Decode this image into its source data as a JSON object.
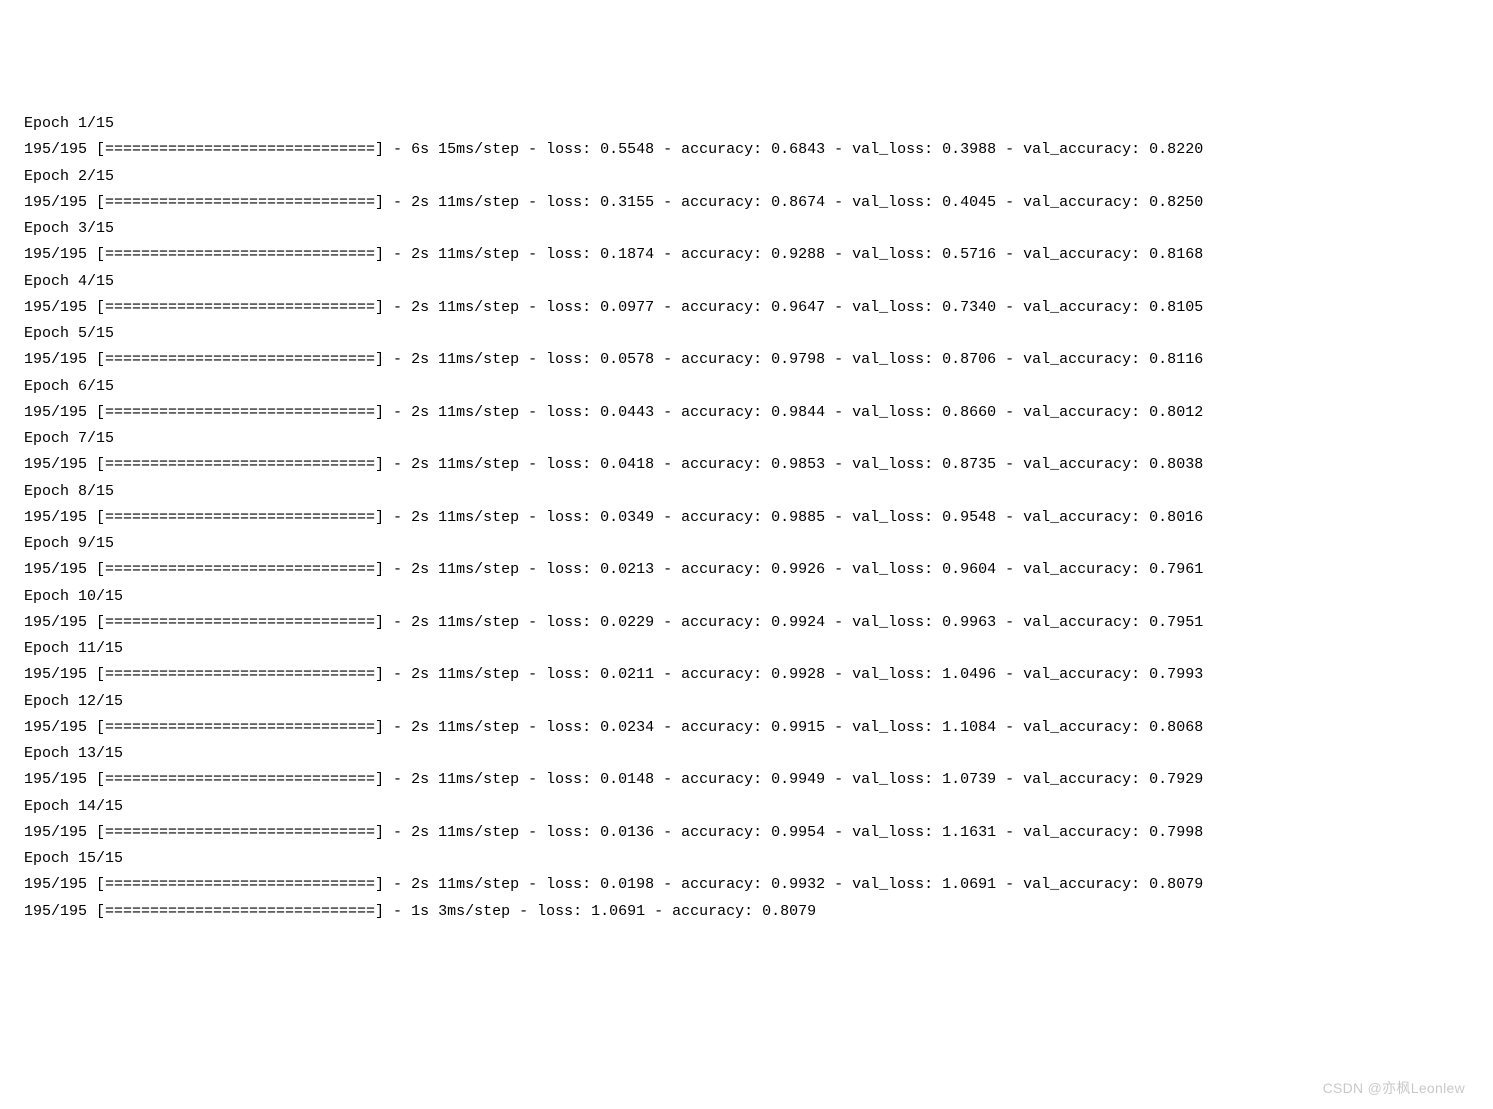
{
  "watermark": "CSDN @亦枫Leonlew",
  "log": {
    "stepsDisplay": "195/195",
    "bar": "[==============================]",
    "totalEpochs": 15,
    "epochs": [
      {
        "epoch": 1,
        "time": "6s 15ms/step",
        "loss": "0.5548",
        "accuracy": "0.6843",
        "val_loss": "0.3988",
        "val_accuracy": "0.8220"
      },
      {
        "epoch": 2,
        "time": "2s 11ms/step",
        "loss": "0.3155",
        "accuracy": "0.8674",
        "val_loss": "0.4045",
        "val_accuracy": "0.8250"
      },
      {
        "epoch": 3,
        "time": "2s 11ms/step",
        "loss": "0.1874",
        "accuracy": "0.9288",
        "val_loss": "0.5716",
        "val_accuracy": "0.8168"
      },
      {
        "epoch": 4,
        "time": "2s 11ms/step",
        "loss": "0.0977",
        "accuracy": "0.9647",
        "val_loss": "0.7340",
        "val_accuracy": "0.8105"
      },
      {
        "epoch": 5,
        "time": "2s 11ms/step",
        "loss": "0.0578",
        "accuracy": "0.9798",
        "val_loss": "0.8706",
        "val_accuracy": "0.8116"
      },
      {
        "epoch": 6,
        "time": "2s 11ms/step",
        "loss": "0.0443",
        "accuracy": "0.9844",
        "val_loss": "0.8660",
        "val_accuracy": "0.8012"
      },
      {
        "epoch": 7,
        "time": "2s 11ms/step",
        "loss": "0.0418",
        "accuracy": "0.9853",
        "val_loss": "0.8735",
        "val_accuracy": "0.8038"
      },
      {
        "epoch": 8,
        "time": "2s 11ms/step",
        "loss": "0.0349",
        "accuracy": "0.9885",
        "val_loss": "0.9548",
        "val_accuracy": "0.8016"
      },
      {
        "epoch": 9,
        "time": "2s 11ms/step",
        "loss": "0.0213",
        "accuracy": "0.9926",
        "val_loss": "0.9604",
        "val_accuracy": "0.7961"
      },
      {
        "epoch": 10,
        "time": "2s 11ms/step",
        "loss": "0.0229",
        "accuracy": "0.9924",
        "val_loss": "0.9963",
        "val_accuracy": "0.7951"
      },
      {
        "epoch": 11,
        "time": "2s 11ms/step",
        "loss": "0.0211",
        "accuracy": "0.9928",
        "val_loss": "1.0496",
        "val_accuracy": "0.7993"
      },
      {
        "epoch": 12,
        "time": "2s 11ms/step",
        "loss": "0.0234",
        "accuracy": "0.9915",
        "val_loss": "1.1084",
        "val_accuracy": "0.8068"
      },
      {
        "epoch": 13,
        "time": "2s 11ms/step",
        "loss": "0.0148",
        "accuracy": "0.9949",
        "val_loss": "1.0739",
        "val_accuracy": "0.7929"
      },
      {
        "epoch": 14,
        "time": "2s 11ms/step",
        "loss": "0.0136",
        "accuracy": "0.9954",
        "val_loss": "1.1631",
        "val_accuracy": "0.7998"
      },
      {
        "epoch": 15,
        "time": "2s 11ms/step",
        "loss": "0.0198",
        "accuracy": "0.9932",
        "val_loss": "1.0691",
        "val_accuracy": "0.8079"
      }
    ],
    "final": {
      "time": "1s 3ms/step",
      "loss": "1.0691",
      "accuracy": "0.8079"
    }
  }
}
